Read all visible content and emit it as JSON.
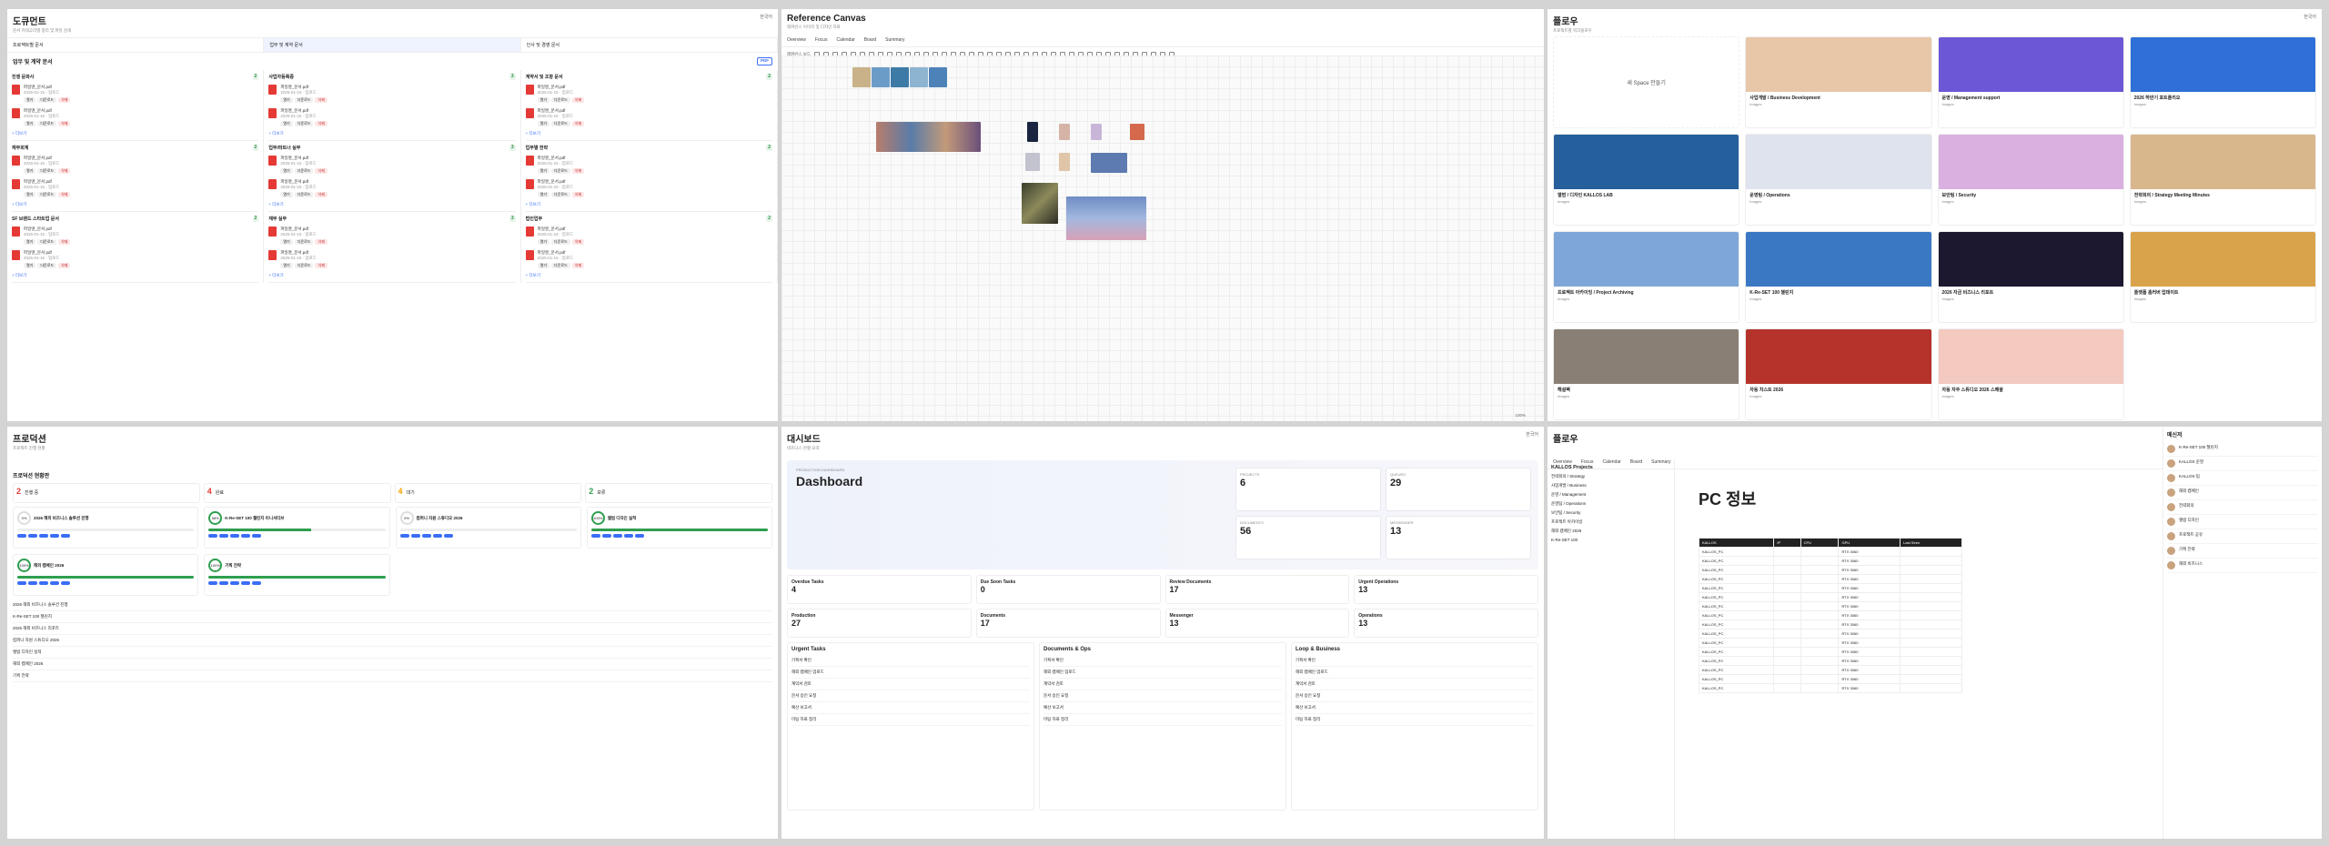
{
  "docs": {
    "title": "도큐먼트",
    "lang": "한국어",
    "subtitle": "문서 카테고리별 정리 및 파일 검색",
    "headers": [
      "프로젝트별 문서",
      "업무 및 계약 문서",
      "인사 및 경영 문서"
    ],
    "section": "업무 및 계약 문서",
    "badge": "PDF",
    "groups": [
      [
        "진행 문화사",
        "2",
        "재무회계",
        "SF 브랜드 스타트업 문서"
      ],
      [
        "사업자등록증",
        "3",
        "업무/파트너 실무",
        "재무 실무"
      ],
      [
        "계약서 및 조항 문서",
        "2",
        "업무별 전략",
        "법인업무"
      ]
    ],
    "file": "파일명_문서.pdf",
    "meta": "2025-01-15 · 업로드",
    "tag1": "열기",
    "tag2": "다운로드",
    "tag3": "삭제",
    "more": "+ 더보기"
  },
  "canvas": {
    "title": "Reference Canvas",
    "subtitle": "레퍼런스 이미지 및 디자인 자료",
    "tabs": [
      "Overview",
      "Focus",
      "Calendar",
      "Board",
      "Summary"
    ],
    "zoom": "100%",
    "footer": "레퍼런스 보드"
  },
  "workflow": {
    "title": "플로우",
    "lang": "한국어",
    "subtitle": "프로젝트별 워크플로우",
    "new": "새 Space 만들기",
    "cards": [
      [
        "사업개발 / Business Development",
        "Images"
      ],
      [
        "운영 / Management support",
        "Images"
      ],
      [
        "2026 하반기 포트폴리오",
        "Images"
      ],
      [
        "앨범 / 디자인 KALLOS LAB",
        "Images"
      ],
      [
        "운영팀 / Operations",
        "Images"
      ],
      [
        "보안팀 / Security",
        "Images"
      ],
      [
        "전략회의 / Strategy Meeting Minutes",
        "Images"
      ],
      [
        "프로젝트 아카이빙 / Project Archiving",
        "Images"
      ],
      [
        "K-Re-SET 100 챌린지",
        "Images"
      ],
      [
        "2026 자금 비즈니스 리포트",
        "Images"
      ],
      [
        "플랫폼 홈러버 업데이트",
        "Images"
      ],
      [
        "해설팩",
        "Images"
      ],
      [
        "자동 차스트 2026",
        "Images"
      ],
      [
        "자동 자주 스튜디오 2026 스페셜",
        "Images"
      ]
    ]
  },
  "projects": {
    "title": "프로덕션",
    "subtitle": "프로젝트 진행 현황",
    "section": "프로덕션 현황판",
    "stats": [
      [
        "2",
        "진행 중"
      ],
      [
        "4",
        "완료"
      ],
      [
        "4",
        "대기"
      ],
      [
        "2",
        "보류"
      ]
    ],
    "cards": [
      [
        "0%",
        "2026 해외 비즈니스 솔루션 진행"
      ],
      [
        "58%",
        "K-Re-SET 100 챌린지 이니셔티브"
      ],
      [
        "0%",
        "컴퍼니 자원 스튜디오 2026"
      ],
      [
        "100%",
        "앨범 디자인 실적"
      ],
      [
        "100%",
        "해외 캠페인 2026"
      ],
      [
        "100%",
        "기획 전략"
      ]
    ],
    "list": [
      "2026 해외 비즈니스 솔루션 진행",
      "K-Re-SET 100 챌린지",
      "2026 해외 비즈니스 리포트",
      "컴퍼니 자원 스튜디오 2026",
      "앨범 디자인 실적",
      "해외 캠페인 2026",
      "기획 전략"
    ]
  },
  "dashboard": {
    "title": "대시보드",
    "lang": "한국어",
    "subtitle": "비즈니스 현황 요약",
    "hero": "Dashboard",
    "kicker": "PRODUCTION DASHBOARD",
    "heroStats": [
      [
        "PROJECTS",
        "6"
      ],
      [
        "QUEUED",
        "29"
      ],
      [
        "DOCUMENTS",
        "56"
      ],
      [
        "MESSENGER",
        "13"
      ]
    ],
    "tasks": [
      [
        "Overdue Tasks",
        "4"
      ],
      [
        "Due Soon Tasks",
        "0"
      ],
      [
        "Review Documents",
        "17"
      ],
      [
        "Urgent Operations",
        "13"
      ]
    ],
    "mods": [
      [
        "Production",
        "27"
      ],
      [
        "Documents",
        "17"
      ],
      [
        "Messenger",
        "13"
      ],
      [
        "Operations",
        "13"
      ]
    ],
    "colTitles": [
      "Urgent Tasks",
      "Documents & Ops",
      "Loop & Business"
    ],
    "items": [
      "기획서 확인",
      "해외 캠페인 업로드",
      "계약서 검토",
      "문서 승인 요청",
      "예산 보고서",
      "미팅 자료 정리"
    ]
  },
  "flow2": {
    "title": "플로우",
    "tabs": [
      "Overview",
      "Focus",
      "Calendar",
      "Board",
      "Summary"
    ],
    "tree": "KALLOS Projects",
    "treeItems": [
      "전략회의 / Strategy",
      "사업개발 / Business",
      "운영 / Management",
      "운영팀 / Operations",
      "보안팀 / Security",
      "프로젝트 아카이빙",
      "해외 캠페인 2026",
      "K-Re-SET 100"
    ],
    "h1": "PC 정보",
    "tableHead": [
      "KALLOS",
      "IP",
      "CPU",
      "GPU",
      "Last Seen"
    ],
    "row": "KALLOS_PC",
    "gpu": "RTX 3060",
    "msgTitle": "메신저",
    "msgs": [
      "K-Re-SET 100 챌린지",
      "KALLOS 운영",
      "KALLOS 팀",
      "해외 캠페인",
      "전략회의",
      "앨범 디자인",
      "프로젝트 공유",
      "기획 전략",
      "해외 비즈니스"
    ]
  }
}
